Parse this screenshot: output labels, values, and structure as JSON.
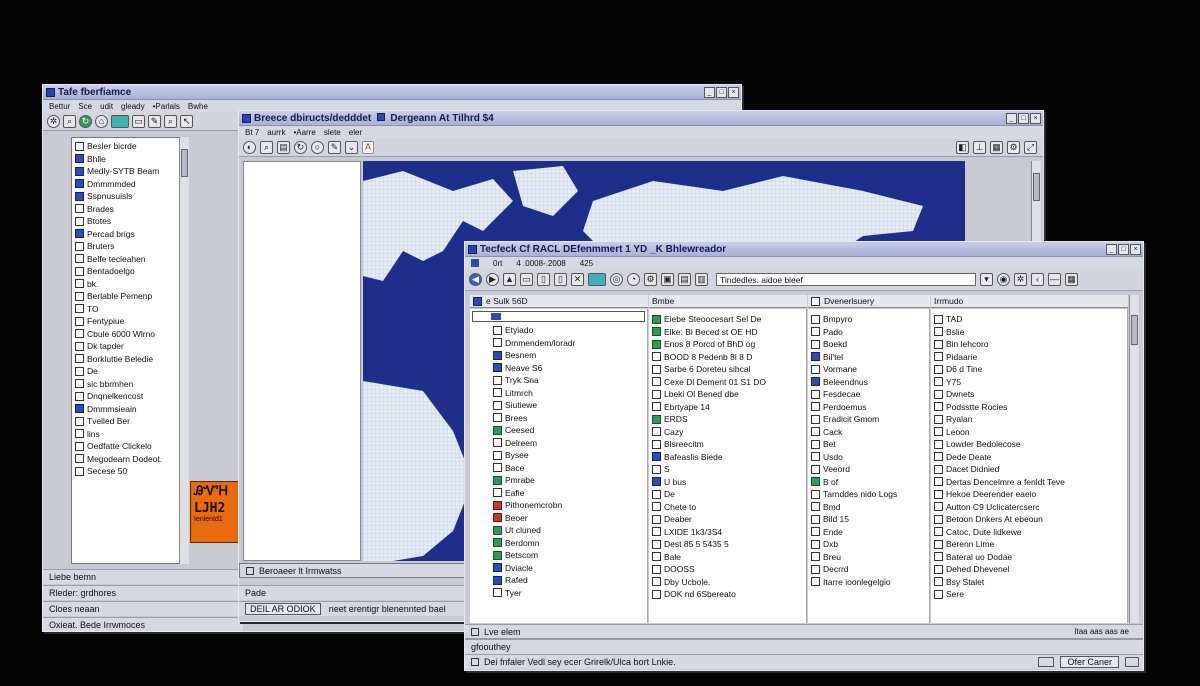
{
  "win1": {
    "title": "Tafe fberfiamce",
    "menu": [
      "Bettur",
      "Sce",
      "udit",
      "gleady",
      "•Parlals",
      "Bwhe"
    ],
    "tree": [
      {
        "icon": "doc",
        "label": "Besler bicrde"
      },
      {
        "icon": "blue",
        "label": "Bhlle"
      },
      {
        "icon": "blue",
        "label": "Medly-SYTB Beam"
      },
      {
        "icon": "blue",
        "label": "Dmmmmded"
      },
      {
        "icon": "blue",
        "label": "Sspnusuisls"
      },
      {
        "icon": "doc",
        "label": "Brades"
      },
      {
        "icon": "doc",
        "label": "Btotes"
      },
      {
        "icon": "blue",
        "label": "Percad brigs"
      },
      {
        "icon": "doc",
        "label": "Bruters"
      },
      {
        "icon": "doc",
        "label": "Belfe tecleahen"
      },
      {
        "icon": "doc",
        "label": "Bentadoelgo"
      },
      {
        "icon": "doc",
        "label": "bk."
      },
      {
        "icon": "doc",
        "label": "Berlable Pemenp"
      },
      {
        "icon": "doc",
        "label": "TO"
      },
      {
        "icon": "doc",
        "label": "Fentypiue"
      },
      {
        "icon": "doc",
        "label": "Cbule 6000 Wlrno"
      },
      {
        "icon": "doc",
        "label": "Dk tapder"
      },
      {
        "icon": "doc",
        "label": "Borkluttie Beledie"
      },
      {
        "icon": "doc",
        "label": "De"
      },
      {
        "icon": "doc",
        "label": "sic bbrmhen"
      },
      {
        "icon": "doc",
        "label": "Dnqnelkencost"
      },
      {
        "icon": "blue",
        "label": "Dmmmsieain"
      },
      {
        "icon": "doc",
        "label": "Tvelled Ber"
      },
      {
        "icon": "doc",
        "label": "lins"
      },
      {
        "icon": "doc",
        "label": "Oedfatte Clickelo"
      },
      {
        "icon": "doc",
        "label": "Megodearn Dodeot."
      },
      {
        "icon": "doc",
        "label": "Secese 50"
      }
    ],
    "badge_top": "ᎯᏉᎻ",
    "badge_mid": "LJH2",
    "badge_bottom": "Ienlentd1",
    "status": [
      "Liebe bemn",
      "Rleder: grdhores",
      "Cloes neaan",
      "Oxieat. Bede Irrwmoces"
    ]
  },
  "win2": {
    "title": "Breece dbiructs/dedddet",
    "title2": "Dergeann At Tilhrd $4",
    "menu": [
      "Bt 7",
      "aurrk",
      "•Aarre",
      "slete",
      "eler"
    ],
    "address": "A",
    "status": [
      "Beroaeer lt Irmwatss",
      "Pade",
      "DEIL AR ODIOK",
      "neet erentigr blenennted bael"
    ]
  },
  "win3": {
    "title": "Tecfeck Cf RACL DEfenmmert 1 YD _K Bhlewreador",
    "menu": [
      "0rt",
      "4 .0008-.2008",
      "425"
    ],
    "search": "Tindedles. aidoe bleef",
    "col1": {
      "header": "e Sulk 56D",
      "items": [
        {
          "icon": "doc",
          "label": "Etyiado"
        },
        {
          "icon": "doc",
          "label": "Dmmendem/loradr"
        },
        {
          "icon": "blue",
          "label": "Besnem"
        },
        {
          "icon": "blue",
          "label": "Neave S6"
        },
        {
          "icon": "doc",
          "label": "Tryk Sna"
        },
        {
          "icon": "doc",
          "label": "Litmrch"
        },
        {
          "icon": "doc",
          "label": "Siutiewe"
        },
        {
          "icon": "doc",
          "label": "Brees"
        },
        {
          "icon": "green",
          "label": "Ceesed"
        },
        {
          "icon": "doc",
          "label": "Delreem"
        },
        {
          "icon": "doc",
          "label": "Bysee"
        },
        {
          "icon": "doc",
          "label": "Bace"
        },
        {
          "icon": "green",
          "label": "Pmrabe"
        },
        {
          "icon": "doc",
          "label": "Eafie"
        },
        {
          "icon": "red",
          "label": "Pithonemcrobn"
        },
        {
          "icon": "red",
          "label": "Beoer"
        },
        {
          "icon": "green",
          "label": "Ut cluned"
        },
        {
          "icon": "green",
          "label": "Berdomn"
        },
        {
          "icon": "green",
          "label": "Betscom"
        },
        {
          "icon": "blue",
          "label": "Dviacle"
        },
        {
          "icon": "blue",
          "label": "Rafed"
        },
        {
          "icon": "doc",
          "label": "Tyer"
        }
      ]
    },
    "col2": {
      "header": "Bmbe",
      "items": [
        {
          "icon": "green",
          "label": "Eiebe Steoocesart Sel De"
        },
        {
          "icon": "green",
          "label": "Elke: Bl Beced st OE HD"
        },
        {
          "icon": "green",
          "label": "Enos 8 Porcd of BhD og"
        },
        {
          "icon": "doc",
          "label": "BOOD 8 Pedenb 8l 8 D"
        },
        {
          "icon": "doc",
          "label": "Sarbe 6 Doreteu sihcal"
        },
        {
          "icon": "doc",
          "label": "Cexe Dl Dement 01 S1 DO"
        },
        {
          "icon": "doc",
          "label": "Lbeki Ol Bened dbe"
        },
        {
          "icon": "doc",
          "label": "Ebrtyape 14"
        },
        {
          "icon": "green",
          "label": "ERDS"
        },
        {
          "icon": "doc",
          "label": "Cazy"
        },
        {
          "icon": "doc",
          "label": "Blsreecitm"
        },
        {
          "icon": "blue",
          "label": "Bafeaslis Biede"
        },
        {
          "icon": "doc",
          "label": "S"
        },
        {
          "icon": "blue",
          "label": "U bus"
        },
        {
          "icon": "doc",
          "label": "De"
        },
        {
          "icon": "doc",
          "label": "Chete to"
        },
        {
          "icon": "doc",
          "label": "Deaber"
        },
        {
          "icon": "doc",
          "label": "LXIDE 1k3/3S4"
        },
        {
          "icon": "doc",
          "label": "Dest 85 5 5435 5"
        },
        {
          "icon": "doc",
          "label": "Bale"
        },
        {
          "icon": "doc",
          "label": "DOOSS"
        },
        {
          "icon": "doc",
          "label": "Dby Ucbole."
        },
        {
          "icon": "doc",
          "label": "DOK nd 6Sbereato"
        }
      ]
    },
    "col3": {
      "header": "Dvenerlsuery",
      "items": [
        {
          "icon": "doc",
          "label": "Bmpyro"
        },
        {
          "icon": "doc",
          "label": "Pado"
        },
        {
          "icon": "doc",
          "label": "Boekd"
        },
        {
          "icon": "blue",
          "label": "Bil'tel"
        },
        {
          "icon": "doc",
          "label": "Vormane"
        },
        {
          "icon": "blue",
          "label": "Beleendnus"
        },
        {
          "icon": "doc",
          "label": "Fesdecae"
        },
        {
          "icon": "doc",
          "label": "Perdoemus"
        },
        {
          "icon": "doc",
          "label": "Eradicit Gmom"
        },
        {
          "icon": "doc",
          "label": "Cack"
        },
        {
          "icon": "doc",
          "label": "Bet"
        },
        {
          "icon": "doc",
          "label": "Usdo"
        },
        {
          "icon": "doc",
          "label": "Veeord"
        },
        {
          "icon": "green",
          "label": "B of"
        },
        {
          "icon": "doc",
          "label": "Tarnddes nido Logs"
        },
        {
          "icon": "doc",
          "label": "Bmd"
        },
        {
          "icon": "doc",
          "label": "Bild 15"
        },
        {
          "icon": "doc",
          "label": "Ende"
        },
        {
          "icon": "doc",
          "label": "Dxb"
        },
        {
          "icon": "doc",
          "label": "Breu"
        },
        {
          "icon": "doc",
          "label": "Decrrd"
        },
        {
          "icon": "doc",
          "label": "Itarre ioonlegelgio"
        }
      ]
    },
    "col4": {
      "header": "Irrmudo",
      "items": [
        {
          "icon": "doc",
          "label": "TAD"
        },
        {
          "icon": "doc",
          "label": "Bslie"
        },
        {
          "icon": "doc",
          "label": "Bin lehcoro"
        },
        {
          "icon": "doc",
          "label": "Pidaarie"
        },
        {
          "icon": "doc",
          "label": "D6 d Tine"
        },
        {
          "icon": "doc",
          "label": "Y75"
        },
        {
          "icon": "doc",
          "label": "Dwnets"
        },
        {
          "icon": "doc",
          "label": "Podsstte Rocies"
        },
        {
          "icon": "doc",
          "label": "Ryalan"
        },
        {
          "icon": "doc",
          "label": "Leoon"
        },
        {
          "icon": "doc",
          "label": "Lowder Bedolecose"
        },
        {
          "icon": "doc",
          "label": "Dede Deate"
        },
        {
          "icon": "doc",
          "label": "Dacet Didnied"
        },
        {
          "icon": "doc",
          "label": "Dertas Dencelmre a fenldt Teve"
        },
        {
          "icon": "doc",
          "label": "Hekoe Deerender eaeio"
        },
        {
          "icon": "doc",
          "label": "Autton C9 Uclicatercserc"
        },
        {
          "icon": "doc",
          "label": "Betoon Dnkers At ebeoun"
        },
        {
          "icon": "doc",
          "label": "Catoc, Dute lidkewe"
        },
        {
          "icon": "doc",
          "label": "Berenn Lime"
        },
        {
          "icon": "doc",
          "label": "Bateral uo Dodae"
        },
        {
          "icon": "doc",
          "label": "Dehed Dhevenel"
        },
        {
          "icon": "doc",
          "label": "Bsy Stalet"
        },
        {
          "icon": "doc",
          "label": "Sere"
        }
      ]
    },
    "status1": "Lve elem",
    "status2": "gfoouthey",
    "status3": "Dei fnfaler Vedl sey ecer Grirelk/Ulca bort Lnkie.",
    "status_right": "Ofer Caner",
    "status_right2": "ltaa aas aas ae"
  },
  "colors": {
    "titlebar": "#aab1d3",
    "map_ocean": "#1d2f8a",
    "map_land": "#dfe6f1",
    "window": "#c7c9d3"
  }
}
